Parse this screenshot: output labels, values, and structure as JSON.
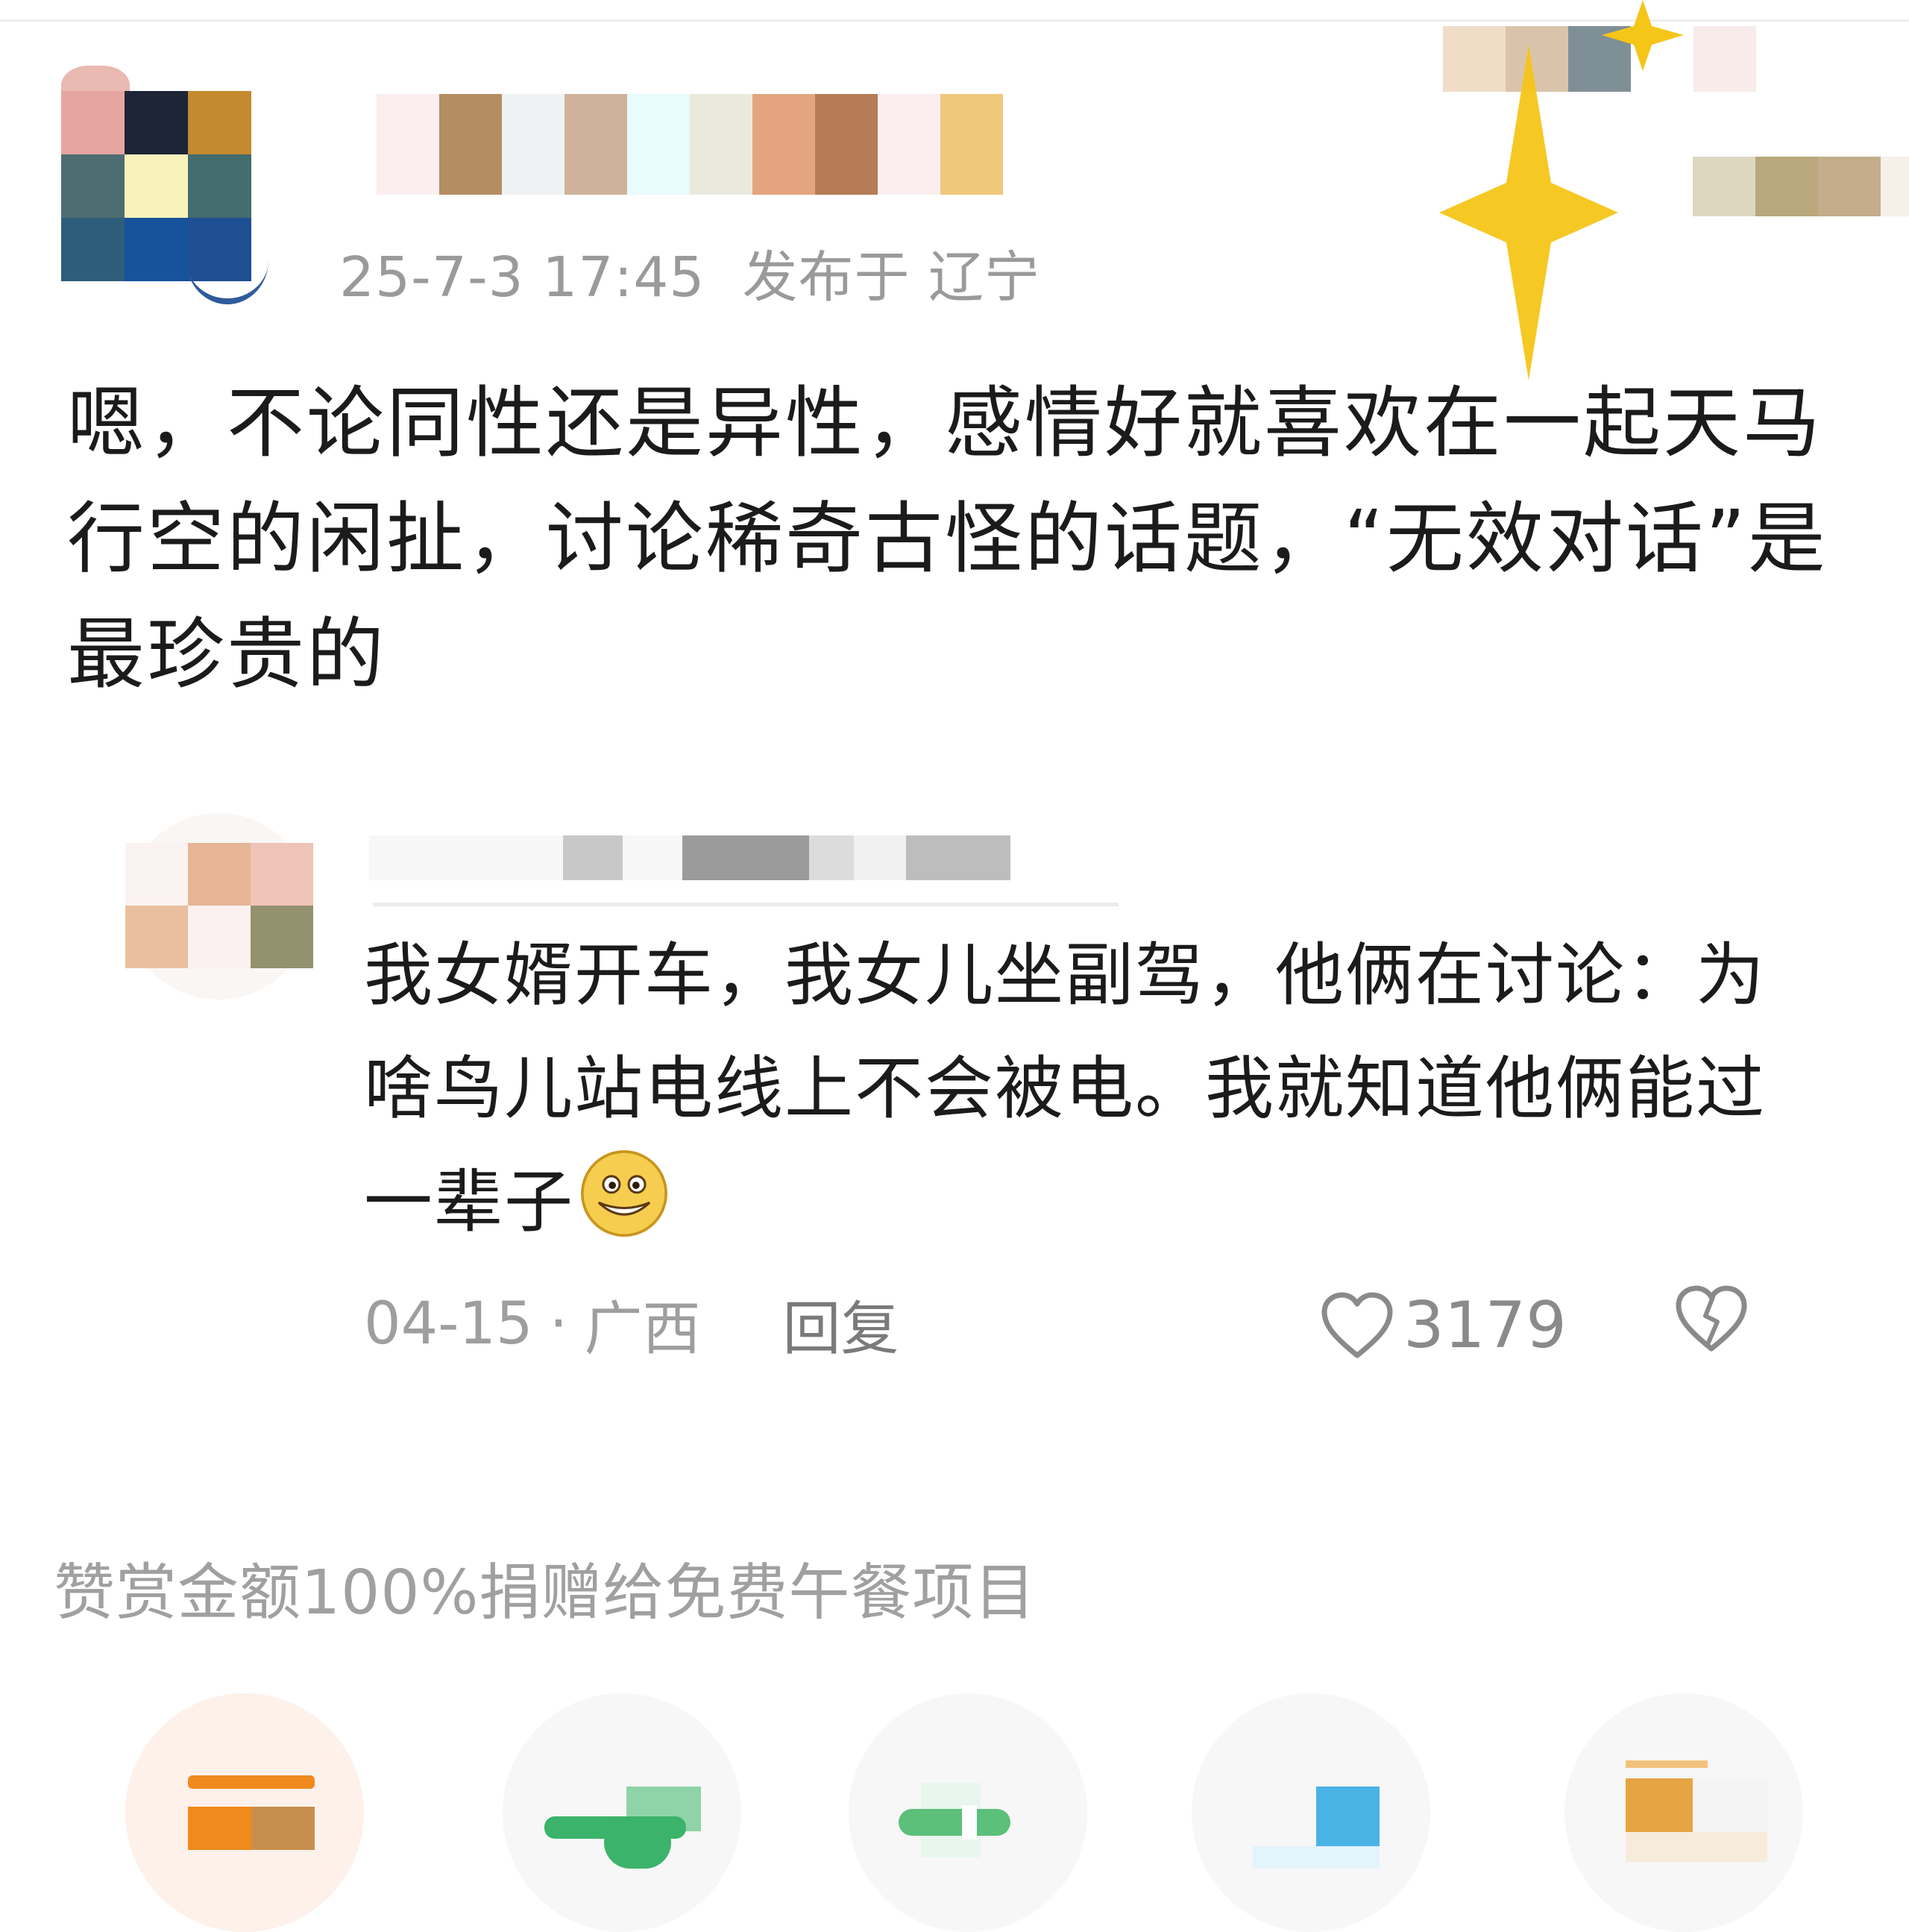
{
  "post": {
    "timestamp": "25-7-3 17:45",
    "location": "发布于 辽宁",
    "text": "嗯，不论同性还是异性，感情好就喜欢在一起天马行空的闲扯，讨论稀奇古怪的话题，“无效对话”是最珍贵的"
  },
  "reply": {
    "text": "我女婿开车，我女儿坐副驾，他俩在讨论：为啥鸟儿站电线上不会被电。我就知道他俩能过一辈子",
    "date": "04-15",
    "separator": "·",
    "region": "广西",
    "reply_label": "回复",
    "like_count": "3179",
    "emoji": "grinning-emoji"
  },
  "reward": {
    "note": "赞赏金额100%捐赠给免费午餐项目"
  },
  "icons": {
    "like": "heart-outline-icon",
    "dislike": "broken-heart-icon",
    "sparkle": "sparkle-sticker"
  },
  "colors": {
    "primary_text": "#1b1b1b",
    "meta_text": "#9a9a9a",
    "sparkle_yellow": "#f5c518",
    "reward_orange": "#f08a1d",
    "wechat_green": "#3bb36a"
  }
}
